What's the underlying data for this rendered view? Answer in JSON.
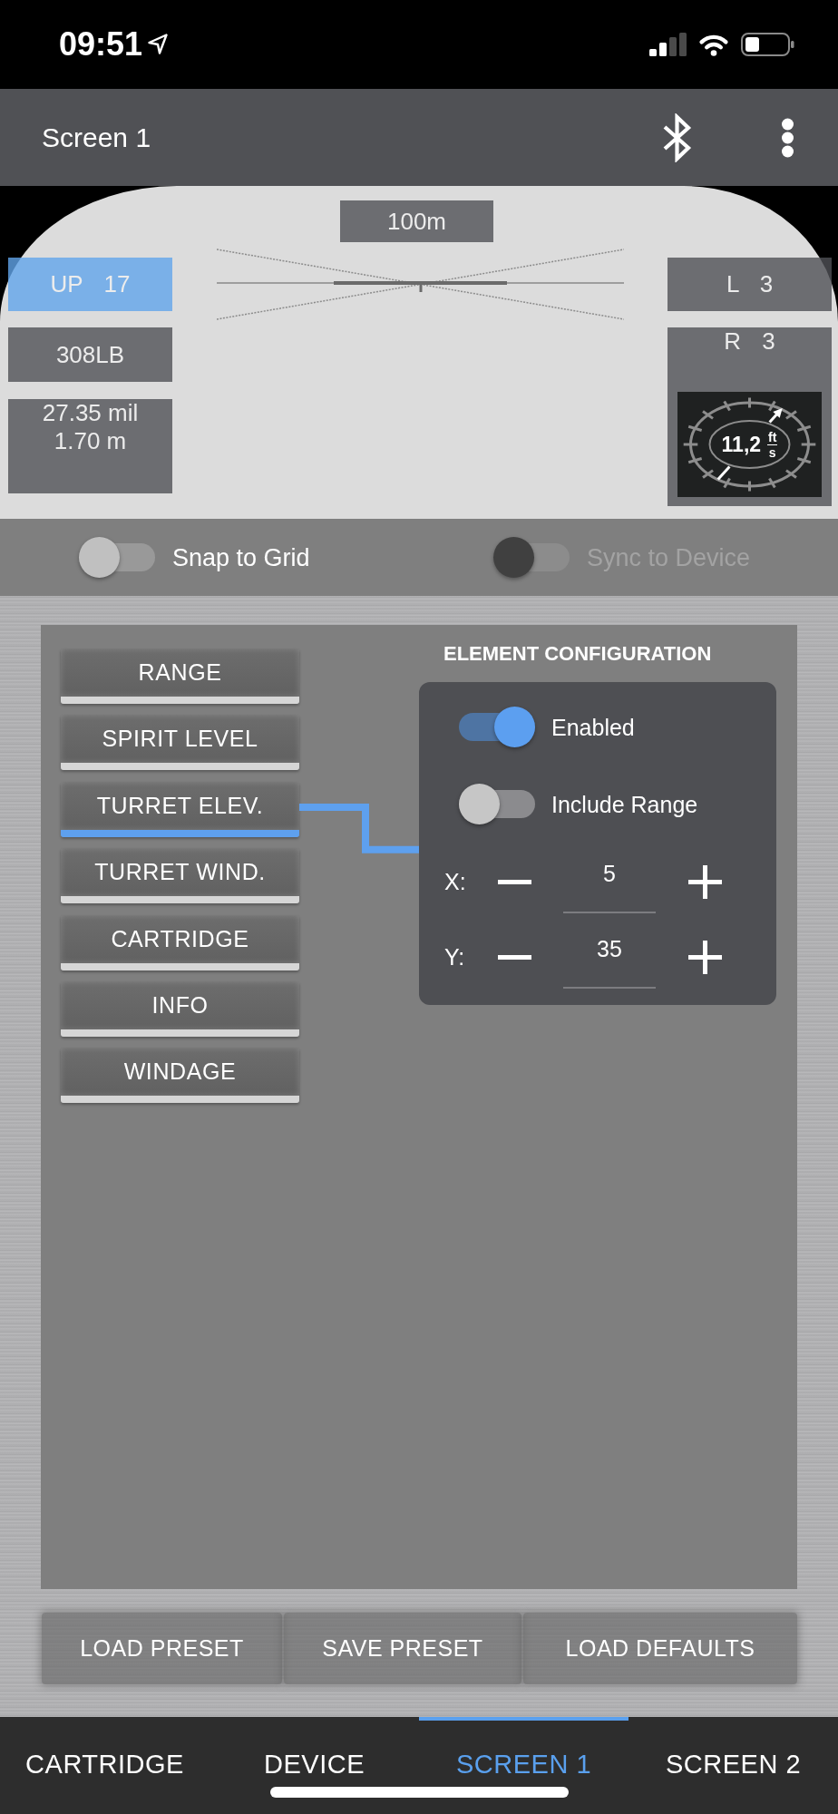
{
  "status_bar": {
    "time": "09:51"
  },
  "header": {
    "title": "Screen 1"
  },
  "preview": {
    "elements": [
      {
        "kind": "range",
        "text": "100m",
        "selected": false
      },
      {
        "kind": "turret_elevation",
        "text": "UP 17",
        "selected": true
      },
      {
        "kind": "cartridge",
        "text": "308LB",
        "selected": false
      },
      {
        "kind": "info",
        "lines": [
          "27.35 mil",
          "1.70 m"
        ],
        "selected": false
      },
      {
        "kind": "turret_windage",
        "text": "L 3",
        "selected": false
      },
      {
        "kind": "windage",
        "text": "R 3",
        "selected": false,
        "gauge": {
          "value": "11,2",
          "unit_top": "ft",
          "unit_bottom": "s"
        }
      }
    ]
  },
  "grid_toggles": [
    {
      "label": "Snap to Grid",
      "on": false,
      "disabled": false
    },
    {
      "label": "Sync to Device",
      "on": false,
      "disabled": true
    }
  ],
  "element_list": [
    {
      "label": "RANGE",
      "selected": false
    },
    {
      "label": "SPIRIT LEVEL",
      "selected": false
    },
    {
      "label": "TURRET ELEV.",
      "selected": true
    },
    {
      "label": "TURRET WIND.",
      "selected": false
    },
    {
      "label": "CARTRIDGE",
      "selected": false
    },
    {
      "label": "INFO",
      "selected": false
    },
    {
      "label": "WINDAGE",
      "selected": false
    }
  ],
  "element_configuration": {
    "title": "ELEMENT CONFIGURATION",
    "switches": [
      {
        "label": "Enabled",
        "on": true
      },
      {
        "label": "Include Range",
        "on": false
      }
    ],
    "coordinates": [
      {
        "label": "X:",
        "value": "5"
      },
      {
        "label": "Y:",
        "value": "35"
      }
    ]
  },
  "actions": [
    "LOAD PRESET",
    "SAVE PRESET",
    "LOAD DEFAULTS"
  ],
  "tabs": [
    {
      "label": "CARTRIDGE",
      "selected": false
    },
    {
      "label": "DEVICE",
      "selected": false
    },
    {
      "label": "SCREEN 1",
      "selected": true
    },
    {
      "label": "SCREEN 2",
      "selected": false
    }
  ]
}
